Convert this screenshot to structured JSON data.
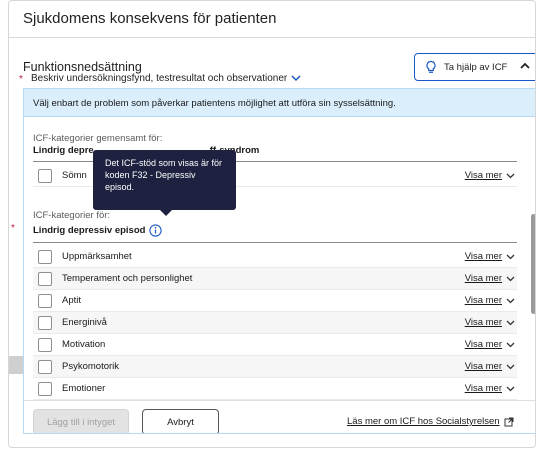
{
  "card": {
    "title": "Sjukdomens konsekvens för patienten"
  },
  "functional": {
    "label": "Funktionsnedsättning",
    "required_mark": "*",
    "description": "Beskriv undersökningsfynd, testresultat och observationer"
  },
  "help_button": {
    "label": "Ta hjälp av ICF",
    "icon": "lightbulb-icon",
    "state_icon": "chevron-up-icon"
  },
  "icf": {
    "banner": "Välj enbart de problem som påverkar patientens möjlighet att utföra sin sysselsättning.",
    "common": {
      "heading": "ICF-kategorier gemensamt för:",
      "name_visible": "Lindrig depre",
      "name_suffix": "ff-syndrom",
      "items": [
        {
          "label": "Sömn",
          "more": "Visa mer"
        }
      ]
    },
    "specific": {
      "heading": "ICF-kategorier för:",
      "required_mark": "*",
      "name": "Lindrig depressiv episod",
      "items": [
        {
          "label": "Uppmärksamhet",
          "more": "Visa mer"
        },
        {
          "label": "Temperament och personlighet",
          "more": "Visa mer"
        },
        {
          "label": "Aptit",
          "more": "Visa mer"
        },
        {
          "label": "Energinivå",
          "more": "Visa mer"
        },
        {
          "label": "Motivation",
          "more": "Visa mer"
        },
        {
          "label": "Psykomotorik",
          "more": "Visa mer"
        },
        {
          "label": "Emotioner",
          "more": "Visa mer"
        }
      ]
    },
    "tooltip": "Det ICF-stöd som visas är för koden F32 - Depressiv episod.",
    "footer": {
      "add_label": "Lägg till i intyget",
      "cancel_label": "Avbryt",
      "read_more": "Läs mer om ICF hos Socialstyrelsen"
    }
  },
  "colors": {
    "accent": "#1a58c6",
    "required": "#c12143",
    "banner_bg": "#daeefb",
    "tooltip_bg": "#1e2240"
  }
}
